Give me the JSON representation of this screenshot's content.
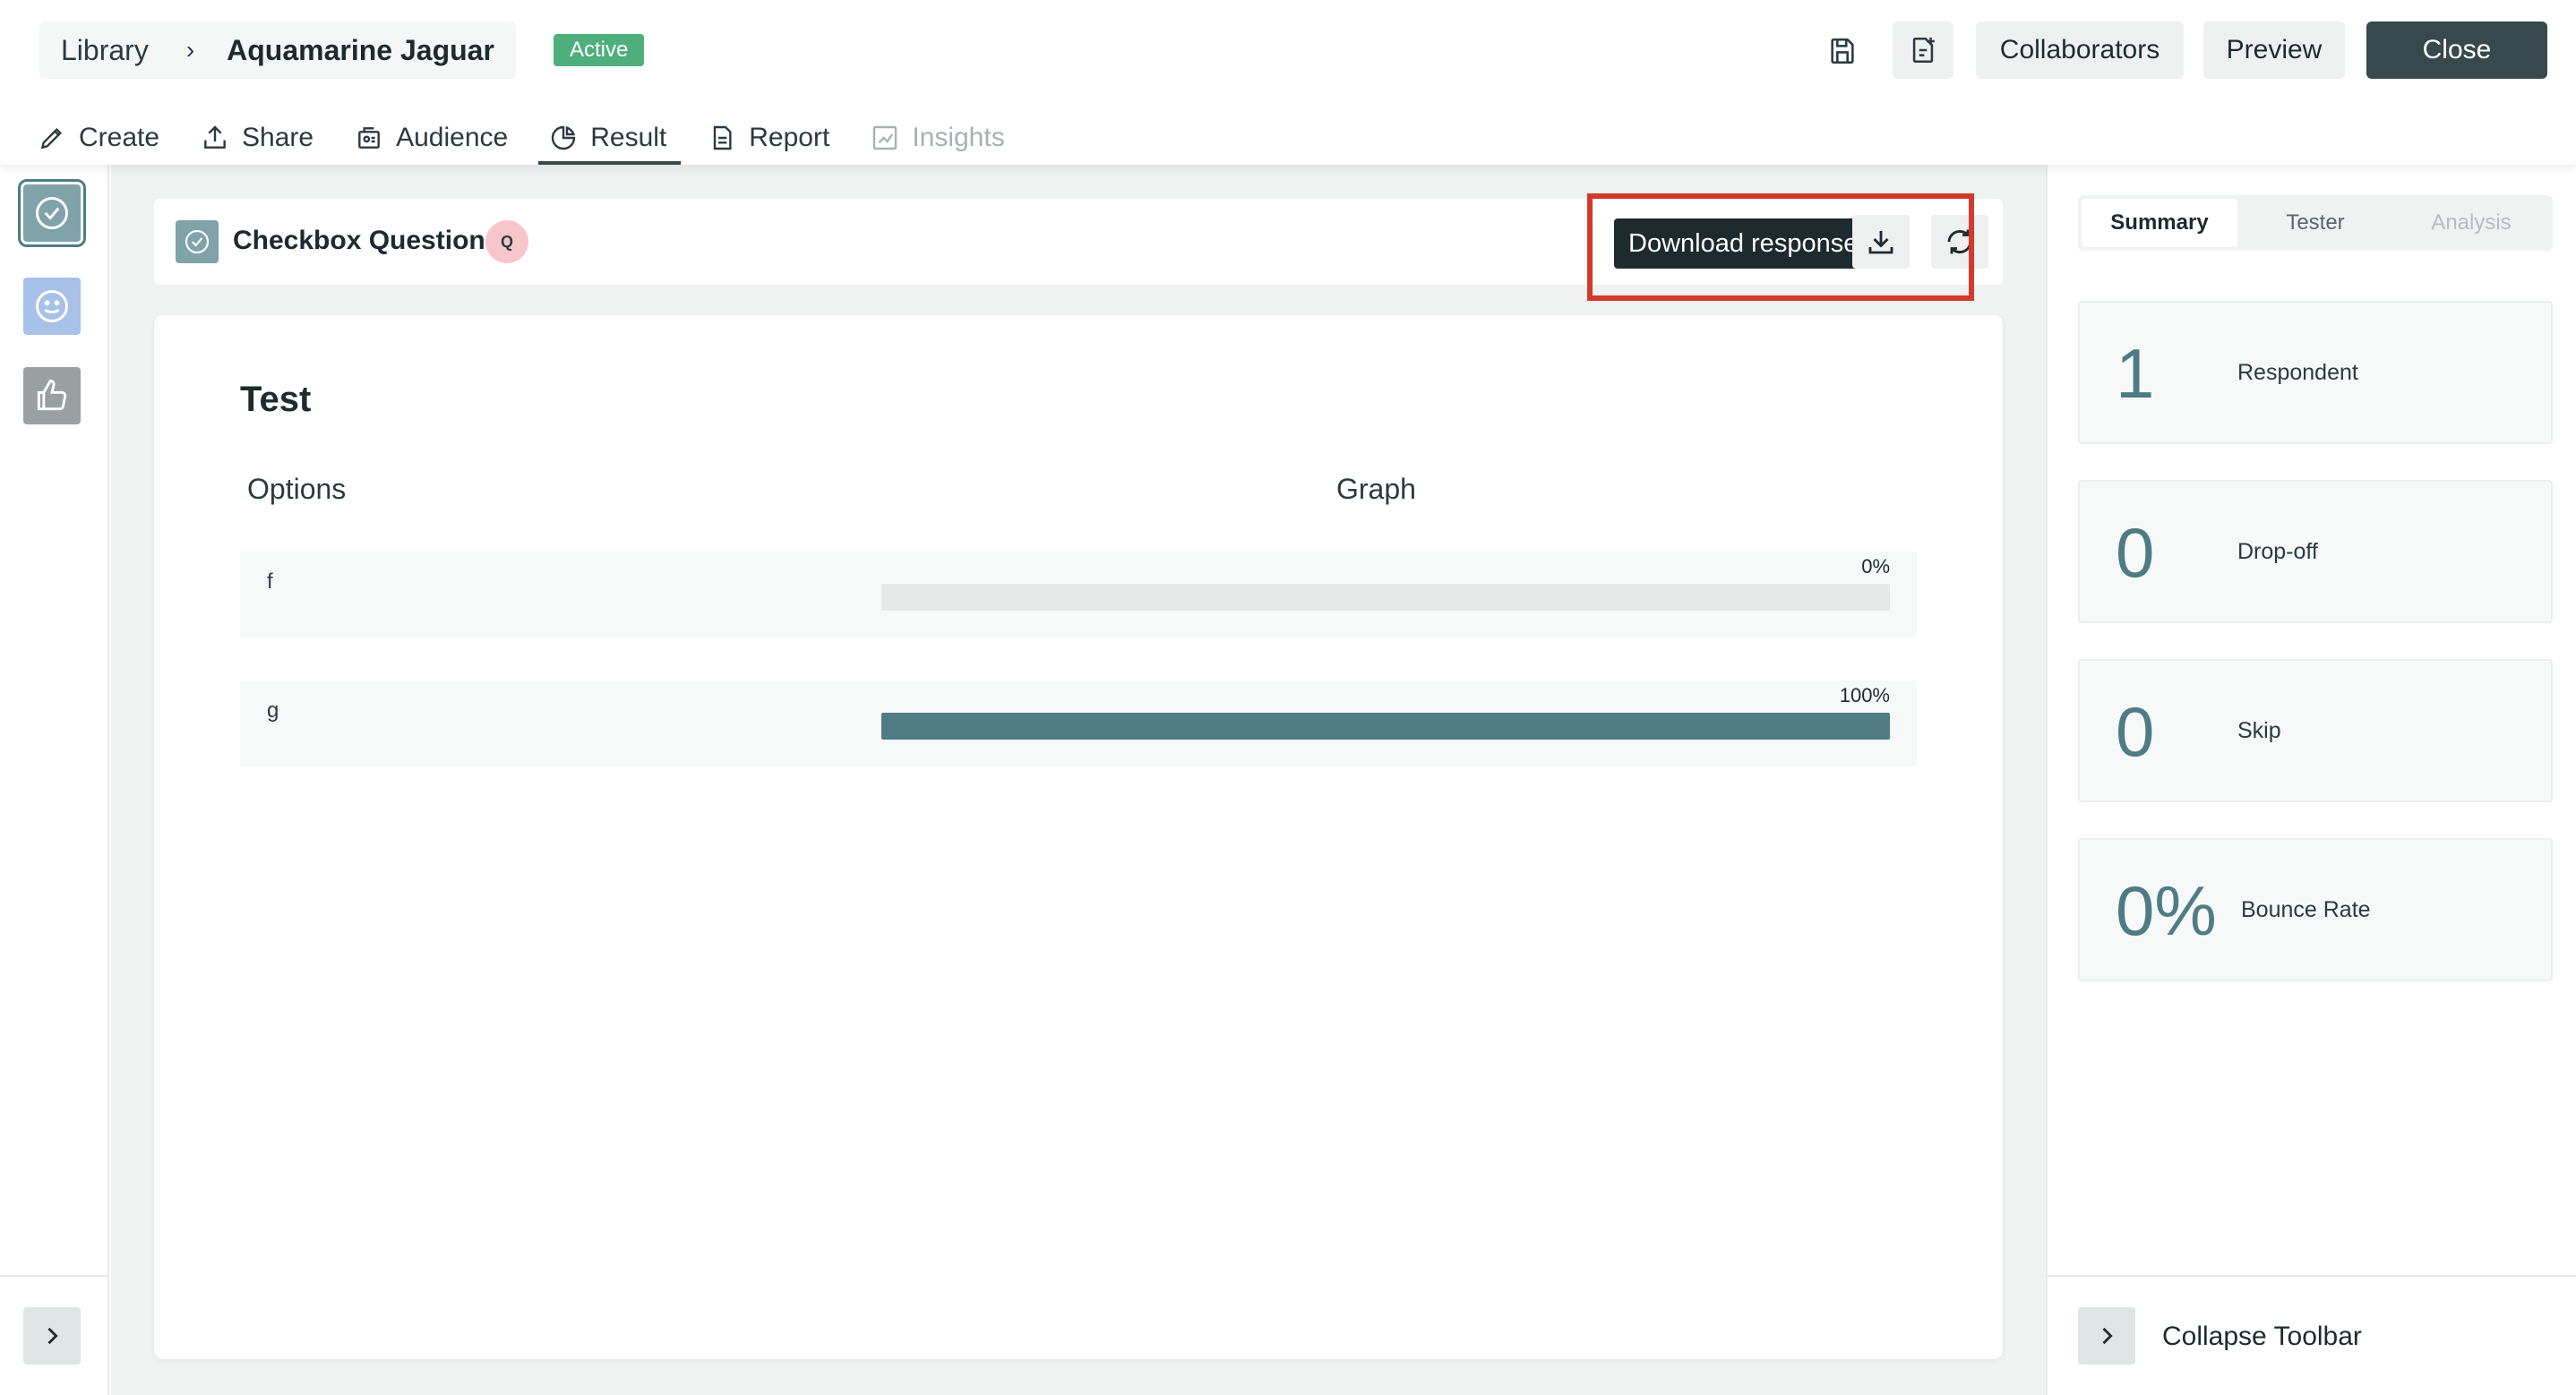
{
  "header": {
    "breadcrumb_root": "Library",
    "breadcrumb_current": "Aquamarine Jaguar",
    "status": "Active",
    "collaborators_label": "Collaborators",
    "preview_label": "Preview",
    "close_label": "Close"
  },
  "tabs": [
    {
      "label": "Create",
      "icon": "pencil-icon"
    },
    {
      "label": "Share",
      "icon": "share-icon"
    },
    {
      "label": "Audience",
      "icon": "audience-icon"
    },
    {
      "label": "Result",
      "icon": "pie-chart-icon",
      "active": true
    },
    {
      "label": "Report",
      "icon": "report-icon"
    },
    {
      "label": "Insights",
      "icon": "insights-icon",
      "disabled": true
    }
  ],
  "question": {
    "type_label": "Checkbox Question",
    "badge": "Q",
    "download_tooltip": "Download response",
    "title": "Test",
    "col_options": "Options",
    "col_graph": "Graph",
    "options": [
      {
        "label": "f",
        "percent_label": "0%",
        "percent": 0
      },
      {
        "label": "g",
        "percent_label": "100%",
        "percent": 100
      }
    ]
  },
  "summary": {
    "tabs": [
      "Summary",
      "Tester",
      "Analysis"
    ],
    "stats": [
      {
        "value": "1",
        "label": "Respondent"
      },
      {
        "value": "0",
        "label": "Drop-off"
      },
      {
        "value": "0",
        "label": "Skip"
      },
      {
        "value": "0%",
        "label": "Bounce Rate"
      }
    ],
    "collapse_label": "Collapse Toolbar"
  },
  "colors": {
    "accent": "#4f7c84",
    "dark_button": "#37494d",
    "active_badge": "#4faf7c",
    "highlight": "#d23a2a"
  }
}
